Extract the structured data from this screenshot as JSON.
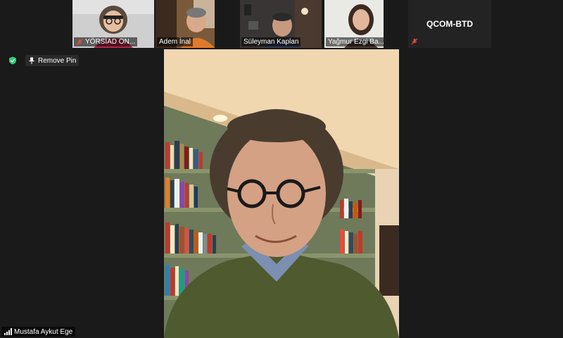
{
  "participants": [
    {
      "name": "YÖRSİAD ON...",
      "muted": true
    },
    {
      "name": "Adem İnal",
      "muted": false
    },
    {
      "name": "Süleyman Kaplan",
      "muted": false
    },
    {
      "name": "Yağmur Ezgi Ba...",
      "muted": false
    },
    {
      "name": "QCOM-BTD",
      "muted": true
    }
  ],
  "pin": {
    "label": "Remove Pin"
  },
  "main": {
    "speaker_name": "Mustafa Aykut Ege"
  },
  "colors": {
    "secure_green": "#2ecc71",
    "mute_red": "#e74c3c"
  }
}
